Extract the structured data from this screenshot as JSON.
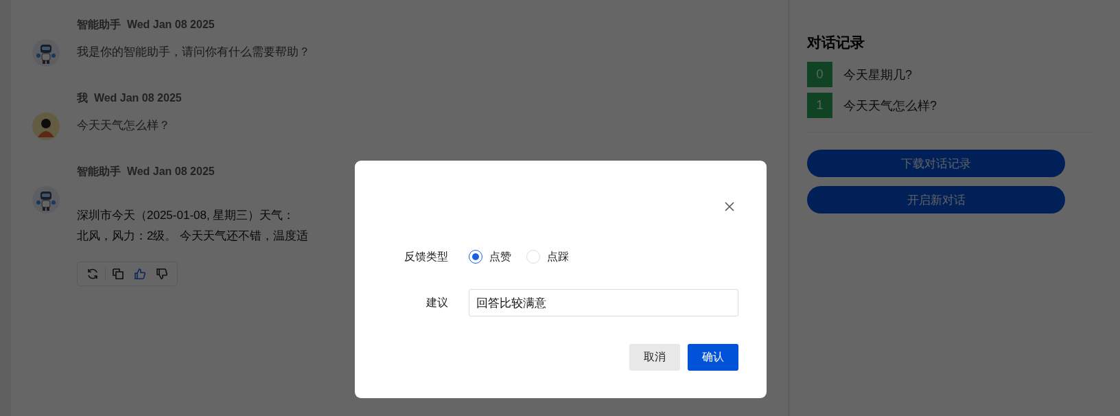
{
  "messages": [
    {
      "kind": "robot",
      "sender": "智能助手",
      "date": "Wed Jan 08 2025",
      "lines": [
        "我是你的智能助手，请问你有什么需要帮助？"
      ]
    },
    {
      "kind": "person",
      "sender": "我",
      "date": "Wed Jan 08 2025",
      "lines": [
        "今天天气怎么样？"
      ]
    },
    {
      "kind": "robot",
      "sender": "智能助手",
      "date": "Wed Jan 08 2025",
      "lines": [
        "深圳市今天（2025-01-08, 星期三）天气：",
        "北风，风力：2级。 今天天气还不错，温度适"
      ],
      "actions": [
        {
          "kind": "refresh",
          "selected": false
        },
        {
          "kind": "copy",
          "selected": false
        },
        {
          "kind": "like",
          "selected": true
        },
        {
          "kind": "dislike",
          "selected": false
        }
      ]
    }
  ],
  "sidebar": {
    "title": "对话记录",
    "items": [
      {
        "index": "0",
        "label": "今天星期几?"
      },
      {
        "index": "1",
        "label": "今天天气怎么样?"
      }
    ],
    "buttons": [
      "下载对话记录",
      "开启新对话"
    ]
  },
  "dialog": {
    "feedback_label": "反馈类型",
    "options": [
      {
        "label": "点赞",
        "selected": true
      },
      {
        "label": "点踩",
        "selected": false
      }
    ],
    "suggestion_label": "建议",
    "suggestion_value": "回答比较满意",
    "buttons": [
      {
        "kind": "secondary",
        "label": "取消"
      },
      {
        "kind": "primary",
        "label": "确认"
      }
    ]
  }
}
